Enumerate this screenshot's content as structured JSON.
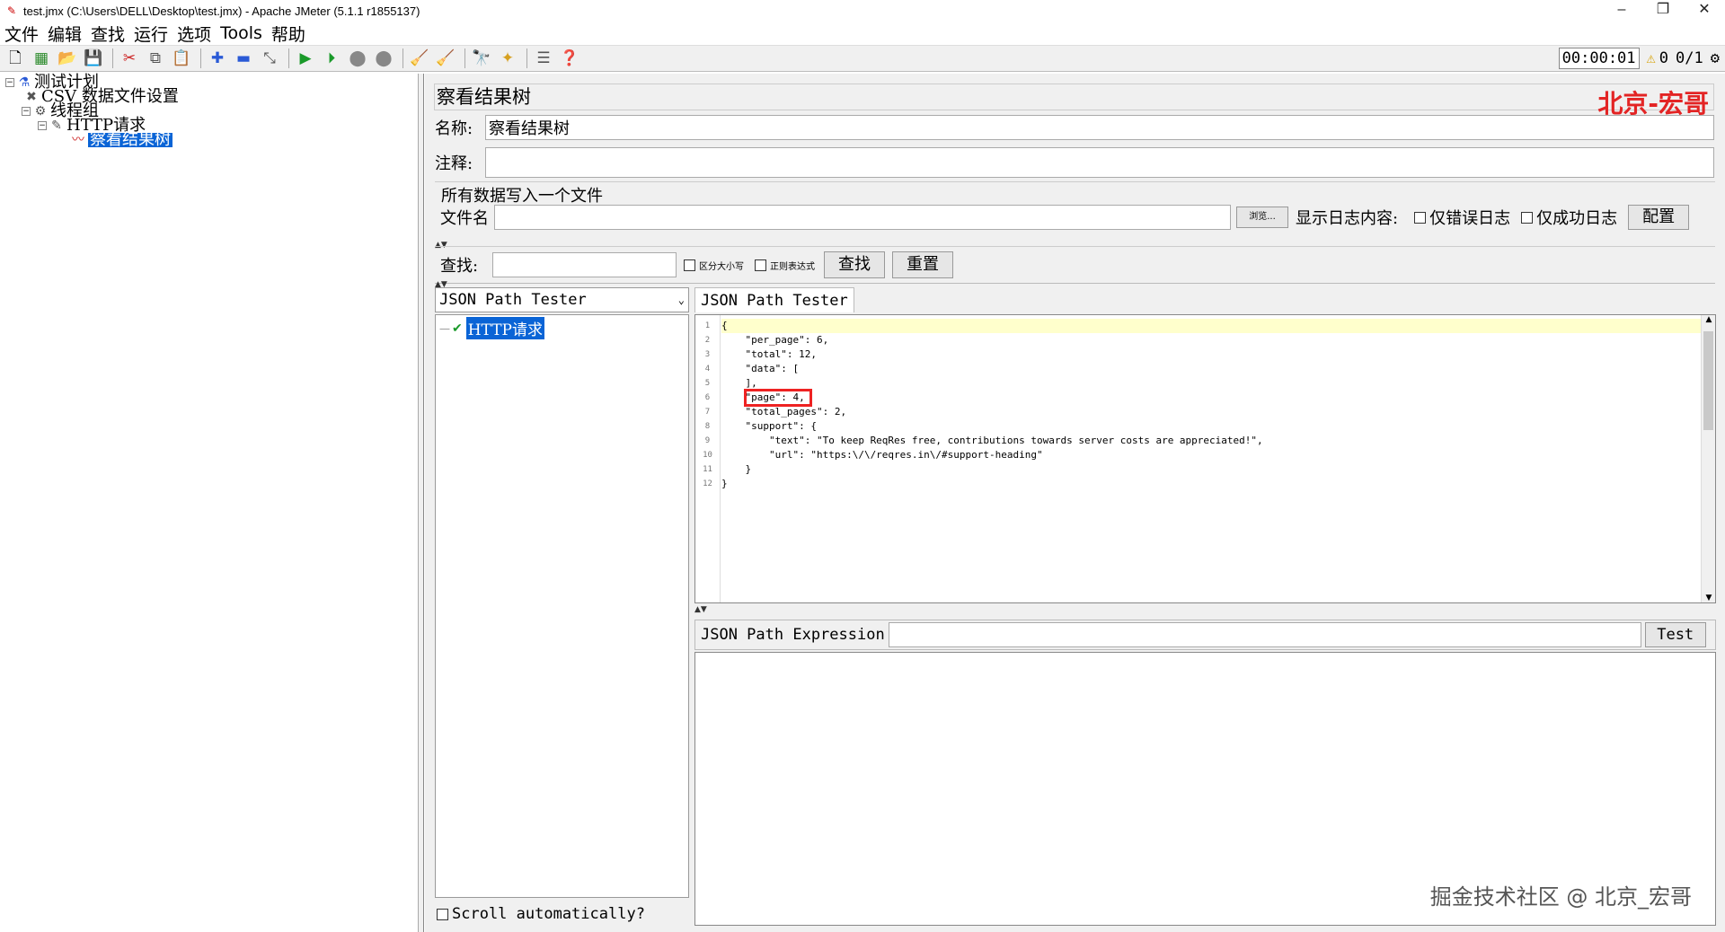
{
  "window": {
    "title": "test.jmx (C:\\Users\\DELL\\Desktop\\test.jmx) - Apache JMeter (5.1.1 r1855137)",
    "minimize": "–",
    "restore": "❐",
    "close": "✕"
  },
  "menu": [
    "文件",
    "编辑",
    "查找",
    "运行",
    "选项",
    "Tools",
    "帮助"
  ],
  "toolbar": {
    "timer": "00:00:01",
    "warning_count": "0",
    "threads": "0/1"
  },
  "tree": {
    "test_plan": "测试计划",
    "csv": "CSV 数据文件设置",
    "thread_group": "线程组",
    "http_request": "HTTP请求",
    "result_tree": "察看结果树"
  },
  "panel": {
    "title": "察看结果树",
    "watermark": "北京-宏哥",
    "name_label": "名称:",
    "name_value": "察看结果树",
    "comment_label": "注释:",
    "comment_value": "",
    "file_group_title": "所有数据写入一个文件",
    "filename_label": "文件名",
    "filename_value": "",
    "browse_button": "浏览...",
    "log_label": "显示日志内容:",
    "errors_only": "仅错误日志",
    "success_only": "仅成功日志",
    "configure_button": "配置"
  },
  "search": {
    "label": "查找:",
    "value": "",
    "case_sensitive": "区分大小写",
    "regex": "正则表达式",
    "find_button": "查找",
    "reset_button": "重置"
  },
  "results": {
    "renderer": "JSON Path Tester",
    "sample": "HTTP请求",
    "scroll_auto": "Scroll automatically?"
  },
  "tester": {
    "tab": "JSON Path Tester",
    "line_numbers": [
      "1",
      "2",
      "3",
      "4",
      "5",
      "6",
      "7",
      "8",
      "9",
      "10",
      "11",
      "12"
    ],
    "code_lines": [
      "{",
      "    \"per_page\": 6,",
      "    \"total\": 12,",
      "    \"data\": [",
      "    ],",
      "    \"page\": 4,",
      "    \"total_pages\": 2,",
      "    \"support\": {",
      "        \"text\": \"To keep ReqRes free, contributions towards server costs are appreciated!\",",
      "        \"url\": \"https:\\/\\/reqres.in\\/#support-heading\"",
      "    }",
      "}"
    ],
    "expression_label": "JSON Path Expression",
    "expression_value": "",
    "test_button": "Test",
    "result_value": ""
  },
  "footer_watermark": "掘金技术社区 @ 北京_宏哥"
}
